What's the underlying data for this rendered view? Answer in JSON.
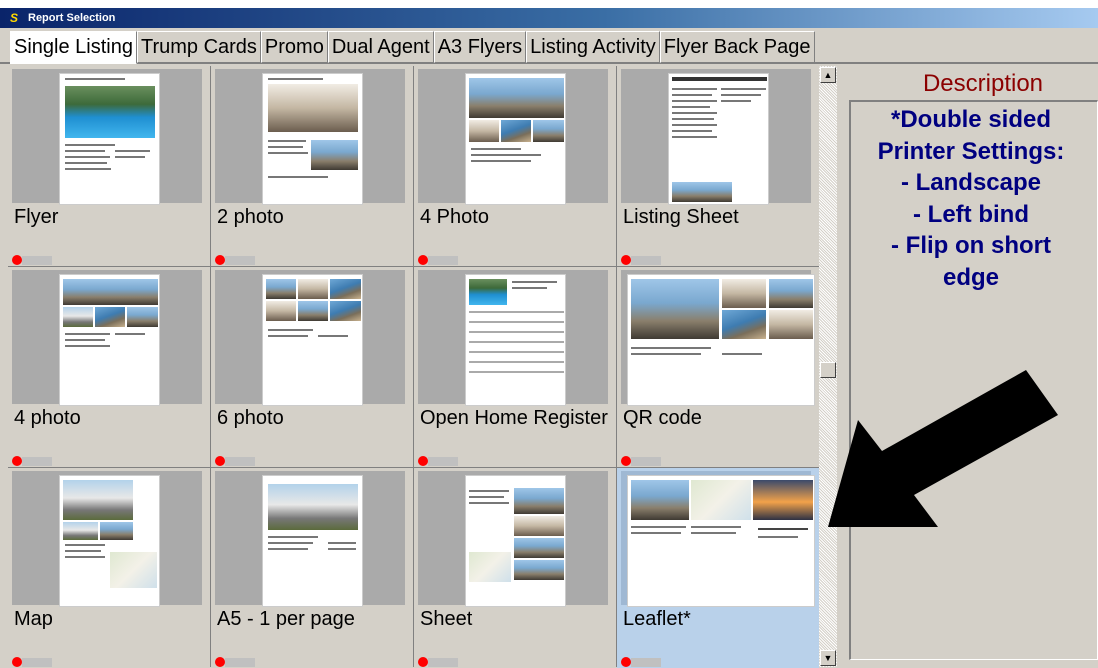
{
  "window": {
    "title": "Report Selection",
    "icon": "S"
  },
  "tabs": [
    {
      "label": "Single Listing",
      "active": true
    },
    {
      "label": "Trump Cards",
      "active": false
    },
    {
      "label": "Promo",
      "active": false
    },
    {
      "label": "Dual Agent",
      "active": false
    },
    {
      "label": "A3 Flyers",
      "active": false
    },
    {
      "label": "Listing Activity",
      "active": false
    },
    {
      "label": "Flyer Back Page",
      "active": false
    }
  ],
  "reports": [
    {
      "label": "Flyer",
      "thumbnail": "portrait-pool",
      "selected": false
    },
    {
      "label": "2 photo",
      "thumbnail": "portrait-2photo",
      "selected": false
    },
    {
      "label": "4 Photo",
      "thumbnail": "portrait-4photo",
      "selected": false
    },
    {
      "label": "Listing Sheet",
      "thumbnail": "portrait-sheet",
      "selected": false
    },
    {
      "label": "4 photo",
      "thumbnail": "portrait-4photo-b",
      "selected": false
    },
    {
      "label": "6 photo",
      "thumbnail": "portrait-6photo",
      "selected": false
    },
    {
      "label": "Open Home Register",
      "thumbnail": "portrait-register",
      "selected": false
    },
    {
      "label": "QR code",
      "thumbnail": "landscape-qr",
      "selected": false
    },
    {
      "label": "Map",
      "thumbnail": "portrait-map",
      "selected": false
    },
    {
      "label": "A5 - 1 per page",
      "thumbnail": "portrait-a5",
      "selected": false
    },
    {
      "label": "Sheet",
      "thumbnail": "portrait-sheet-map",
      "selected": false
    },
    {
      "label": "Leaflet*",
      "thumbnail": "landscape-leaflet",
      "selected": true
    }
  ],
  "description": {
    "label": "Description",
    "text": "*Double sided\nPrinter Settings:\n- Landscape\n- Left bind\n- Flip on short\nedge"
  },
  "scrollbar": {
    "up": "▲",
    "down": "▼"
  },
  "colors": {
    "selected": "#b9d1ea",
    "status_dot": "#ff0000",
    "description_text": "#000080",
    "description_label": "#8b0000"
  }
}
